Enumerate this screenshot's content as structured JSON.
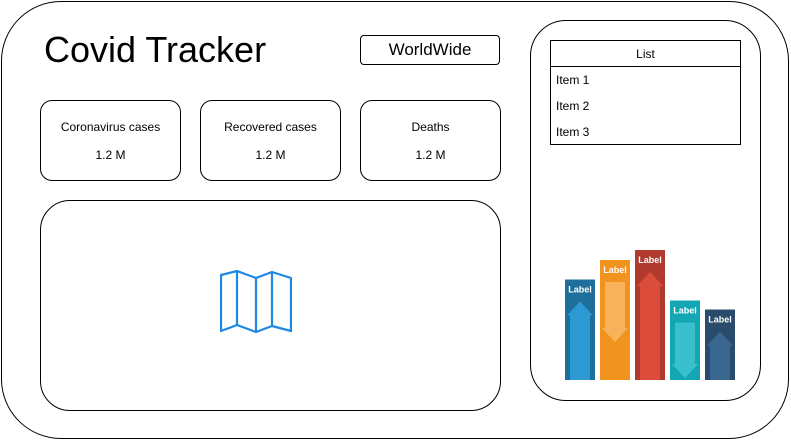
{
  "app": {
    "title": "Covid Tracker"
  },
  "region_selector": {
    "label": "WorldWide"
  },
  "stats": [
    {
      "label": "Coronavirus cases",
      "value": "1.2 M"
    },
    {
      "label": "Recovered cases",
      "value": "1.2 M"
    },
    {
      "label": "Deaths",
      "value": "1.2 M"
    }
  ],
  "map": {
    "icon": "map-icon",
    "color": "#1e88e5"
  },
  "list": {
    "header": "List",
    "items": [
      "Item 1",
      "Item 2",
      "Item 3"
    ]
  },
  "infographic": {
    "bars": [
      {
        "label": "Label",
        "level": 0.67,
        "direction": "up",
        "color": "#1f6f9c",
        "arrow_color": "#2f9ed9"
      },
      {
        "label": "Label",
        "level": 0.8,
        "direction": "down",
        "color": "#f0931f",
        "arrow_color": "#f8b760"
      },
      {
        "label": "Label",
        "level": 0.87,
        "direction": "up",
        "color": "#b03a2e",
        "arrow_color": "#e04f3c"
      },
      {
        "label": "Label",
        "level": 0.53,
        "direction": "down",
        "color": "#13a7b4",
        "arrow_color": "#3fc2d0"
      },
      {
        "label": "Label",
        "level": 0.47,
        "direction": "up",
        "color": "#2a4b6b",
        "arrow_color": "#3c6a95"
      }
    ]
  }
}
